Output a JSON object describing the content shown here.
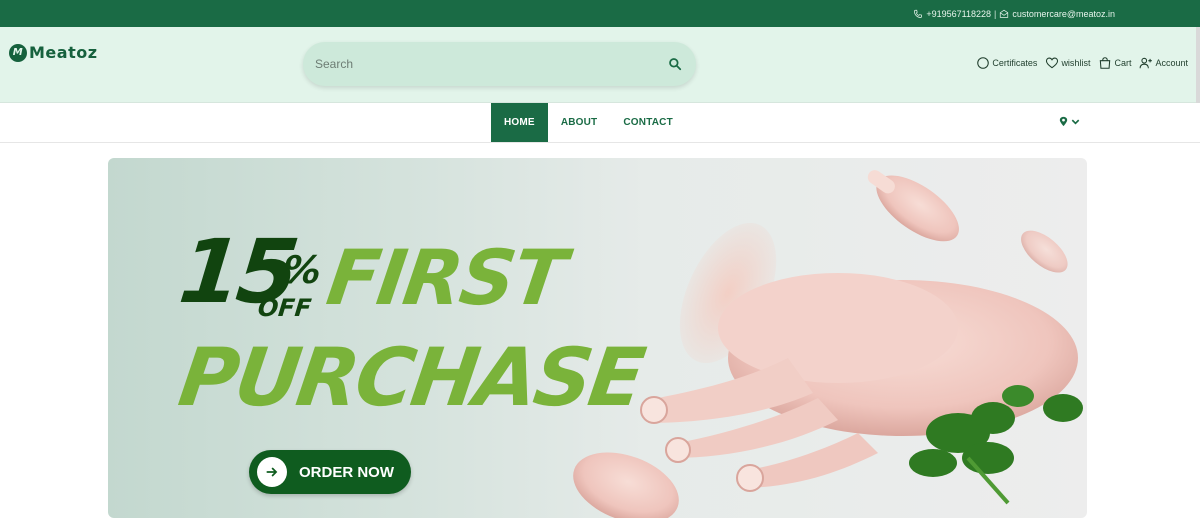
{
  "topbar": {
    "phone": "+919567118228",
    "separator": "|",
    "email": "customercare@meatoz.in"
  },
  "header": {
    "logo_mark": "M",
    "logo_text": "Meatoz",
    "search_placeholder": "Search",
    "actions": [
      {
        "label": "Certificates",
        "icon": "certificate-icon"
      },
      {
        "label": "wishlist",
        "icon": "heart-icon"
      },
      {
        "label": "Cart",
        "icon": "bag-icon"
      },
      {
        "label": "Account",
        "icon": "user-plus-icon"
      }
    ]
  },
  "nav": {
    "links": [
      {
        "label": "HOME",
        "active": true
      },
      {
        "label": "ABOUT",
        "active": false
      },
      {
        "label": "CONTACT",
        "active": false
      }
    ],
    "location_icon": "location-pin-icon"
  },
  "banner": {
    "discount": "15",
    "percent_sign": "%",
    "off": "OFF",
    "line1": "FIRST",
    "line2": "PURCHASE",
    "cta": "ORDER NOW",
    "image": "raw chicken legs with parsley"
  },
  "colors": {
    "brand_green": "#1a6b45",
    "header_bg": "#e2f4ea",
    "headline_dark": "#11440f",
    "headline_light": "#7ab33a"
  }
}
